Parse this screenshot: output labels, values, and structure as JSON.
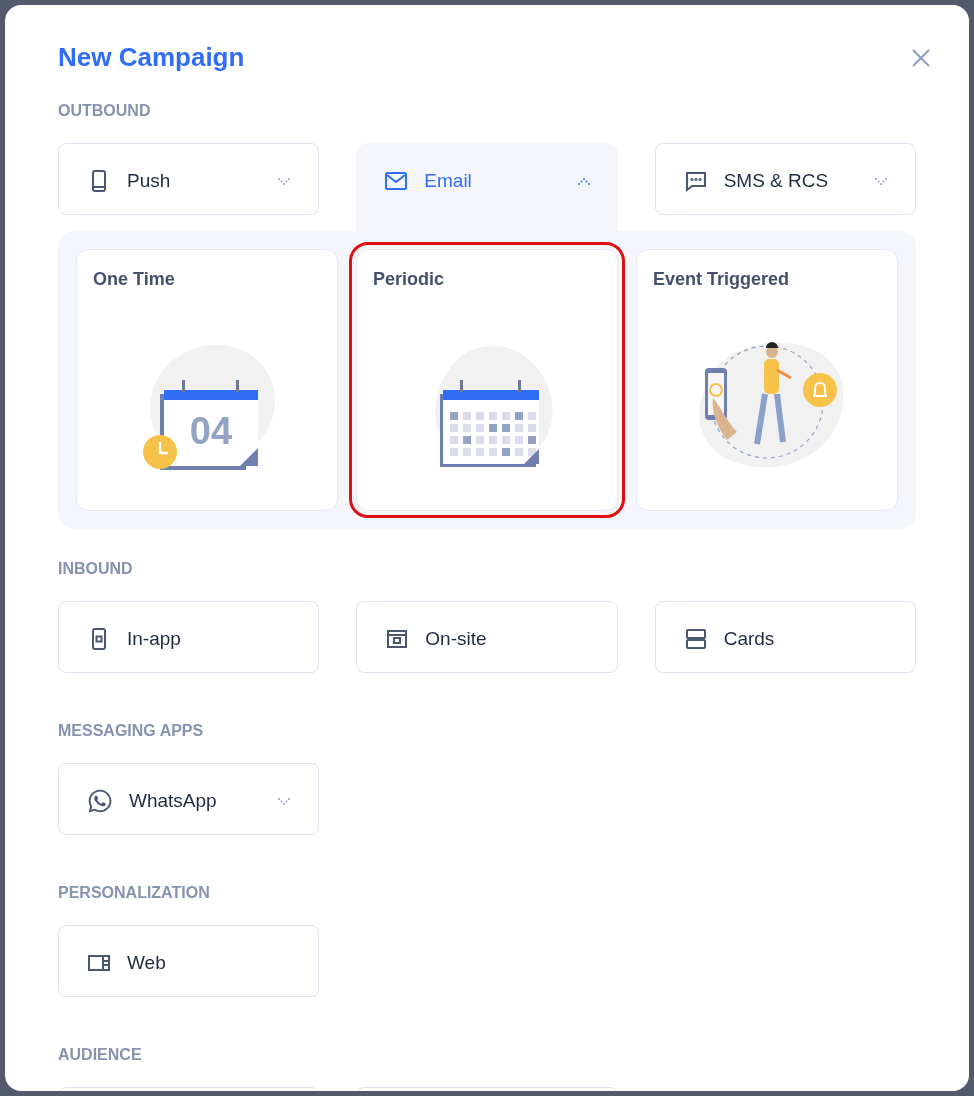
{
  "dialog": {
    "title": "New Campaign"
  },
  "sections": [
    {
      "label": "OUTBOUND",
      "items": [
        {
          "kind": "phone",
          "label": "Push",
          "dropdown": true,
          "selected": false
        },
        {
          "kind": "mail",
          "label": "Email",
          "dropdown": true,
          "selected": true,
          "options": [
            {
              "kind": "calendar-alarm",
              "label": "One Time",
              "date": "04",
              "highlighted": false
            },
            {
              "kind": "calendar-grid",
              "label": "Periodic",
              "highlighted": true
            },
            {
              "kind": "person-phone",
              "label": "Event Triggered",
              "highlighted": false
            }
          ]
        },
        {
          "kind": "chat",
          "label": "SMS & RCS",
          "dropdown": true,
          "selected": false
        }
      ]
    },
    {
      "label": "INBOUND",
      "items": [
        {
          "kind": "inapp",
          "label": "In-app",
          "dropdown": false,
          "selected": false
        },
        {
          "kind": "onsite",
          "label": "On-site",
          "dropdown": false,
          "selected": false
        },
        {
          "kind": "cards",
          "label": "Cards",
          "dropdown": false,
          "selected": false
        }
      ]
    },
    {
      "label": "MESSAGING APPS",
      "items": [
        {
          "kind": "whatsapp",
          "label": "WhatsApp",
          "dropdown": true,
          "selected": false
        }
      ]
    },
    {
      "label": "PERSONALIZATION",
      "items": [
        {
          "kind": "web",
          "label": "Web",
          "dropdown": false,
          "selected": false
        }
      ]
    },
    {
      "label": "AUDIENCE"
    }
  ]
}
